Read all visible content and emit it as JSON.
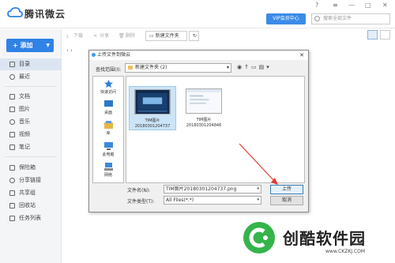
{
  "app": {
    "title": "腾讯微云"
  },
  "topbar": {
    "vip_label": "VIP会员中心",
    "search_placeholder": "搜索全部文件",
    "window_controls": [
      "?",
      "≡",
      "—",
      "□",
      "✕"
    ]
  },
  "sidebar": {
    "add_label": "+ 添加",
    "items": [
      {
        "label": "目录",
        "icon": "folder-icon"
      },
      {
        "label": "最近",
        "icon": "clock-icon"
      },
      {
        "label": "文档",
        "icon": "document-icon"
      },
      {
        "label": "图片",
        "icon": "image-icon"
      },
      {
        "label": "音乐",
        "icon": "music-icon"
      },
      {
        "label": "视频",
        "icon": "video-icon"
      },
      {
        "label": "笔记",
        "icon": "note-icon"
      },
      {
        "label": "保险箱",
        "icon": "safe-icon"
      },
      {
        "label": "分享链接",
        "icon": "link-icon"
      },
      {
        "label": "共享组",
        "icon": "group-icon"
      },
      {
        "label": "回收站",
        "icon": "trash-icon"
      },
      {
        "label": "任务列表",
        "icon": "tasks-icon"
      }
    ]
  },
  "toolbar": {
    "download": "下载",
    "share": "分享",
    "delete": "删除",
    "new_folder": "新建文件夹"
  },
  "breadcrumb": "‹ ›",
  "dialog": {
    "title": "上传文件到微云",
    "look_in_label": "查找范围(I):",
    "look_in_value": "新建文件夹 (2)",
    "places": [
      "快速访问",
      "桌面",
      "库",
      "此电脑",
      "网络"
    ],
    "files": [
      {
        "name": "TIM图片",
        "date": "20180301204737"
      },
      {
        "name": "TIM图片",
        "date": "20180301204846"
      }
    ],
    "filename_label": "文件名(N):",
    "filename_value": "TIM图片20180301204737.png",
    "filetype_label": "文件类型(T):",
    "filetype_value": "All Files(*.*)",
    "upload_label": "上传",
    "cancel_label": "取消"
  },
  "watermark": {
    "text": "创酷软件园",
    "url": "www.CKZKJ.COM"
  },
  "colors": {
    "accent": "#2f82e6",
    "vip": "#3b8be8",
    "selection": "#cce4f7",
    "arrow": "#e03c31"
  }
}
